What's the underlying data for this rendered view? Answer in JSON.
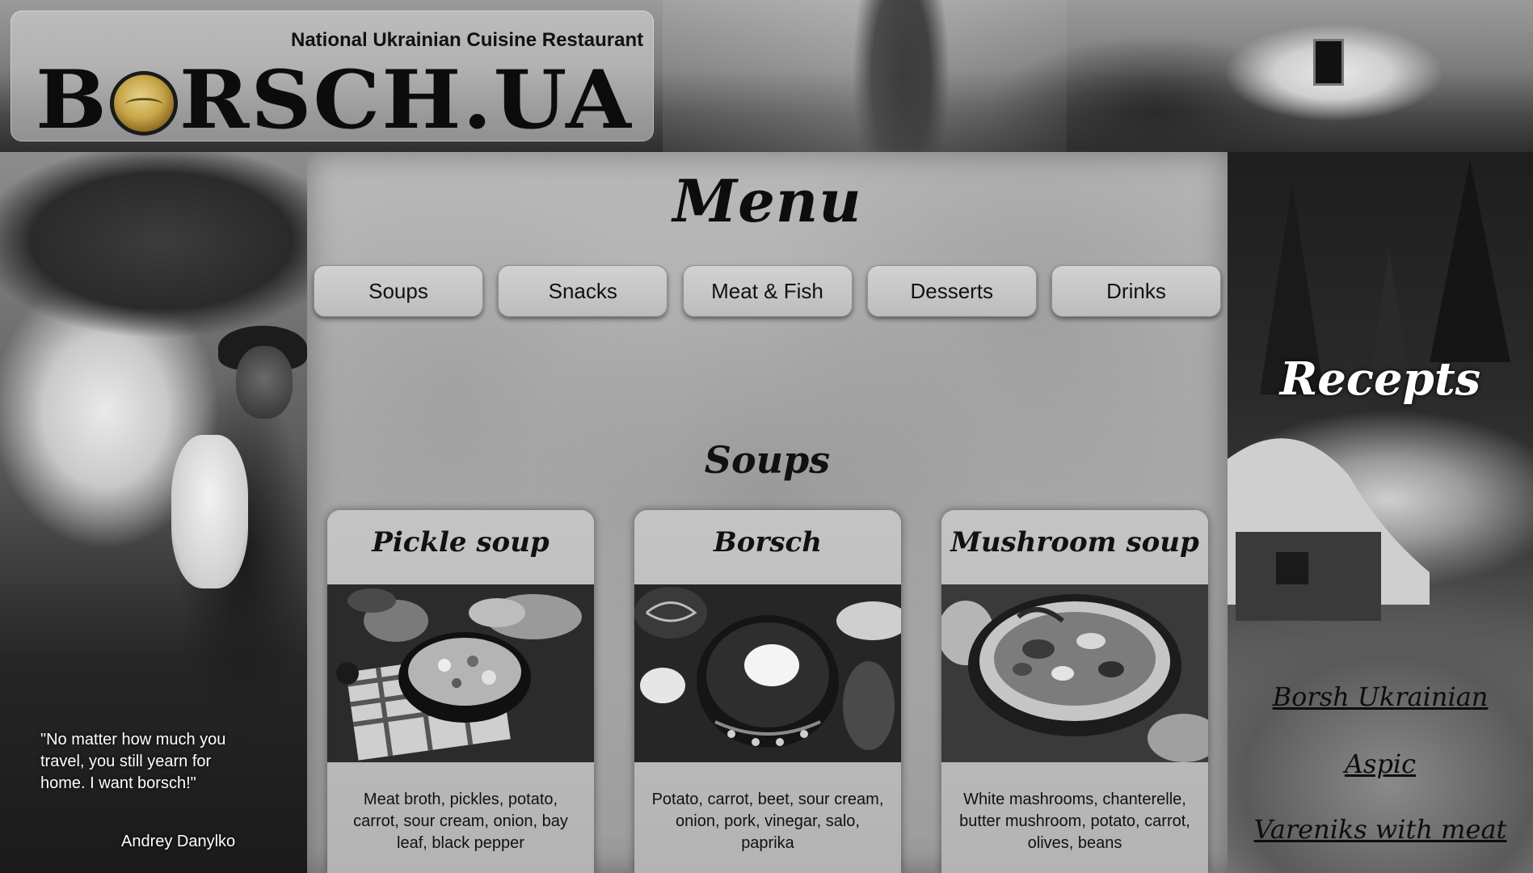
{
  "header": {
    "tagline": "National Ukrainian Cuisine Restaurant",
    "logo_prefix": "B",
    "logo_suffix": "RSCH.UA"
  },
  "left": {
    "quote": "\"No matter how much you travel, you still yearn for home. I want borsch!\"",
    "author": "Andrey Danylko"
  },
  "menu": {
    "title": "Menu",
    "tabs": [
      "Soups",
      "Snacks",
      "Meat & Fish",
      "Desserts",
      "Drinks"
    ],
    "section_title": "Soups",
    "cards": [
      {
        "title": "Pickle soup",
        "description": "Meat broth, pickles, potato, carrot, sour cream, onion, bay leaf, black pepper"
      },
      {
        "title": "Borsch",
        "description": "Potato, carrot, beet, sour cream, onion, pork, vinegar, salo, paprika"
      },
      {
        "title": "Mushroom soup",
        "description": "White mashrooms, chanterelle, butter mushroom, potato, carrot, olives, beans"
      }
    ]
  },
  "right": {
    "title": "Recepts",
    "links": [
      "Borsh Ukrainian",
      "Aspic",
      "Vareniks with meat"
    ]
  }
}
